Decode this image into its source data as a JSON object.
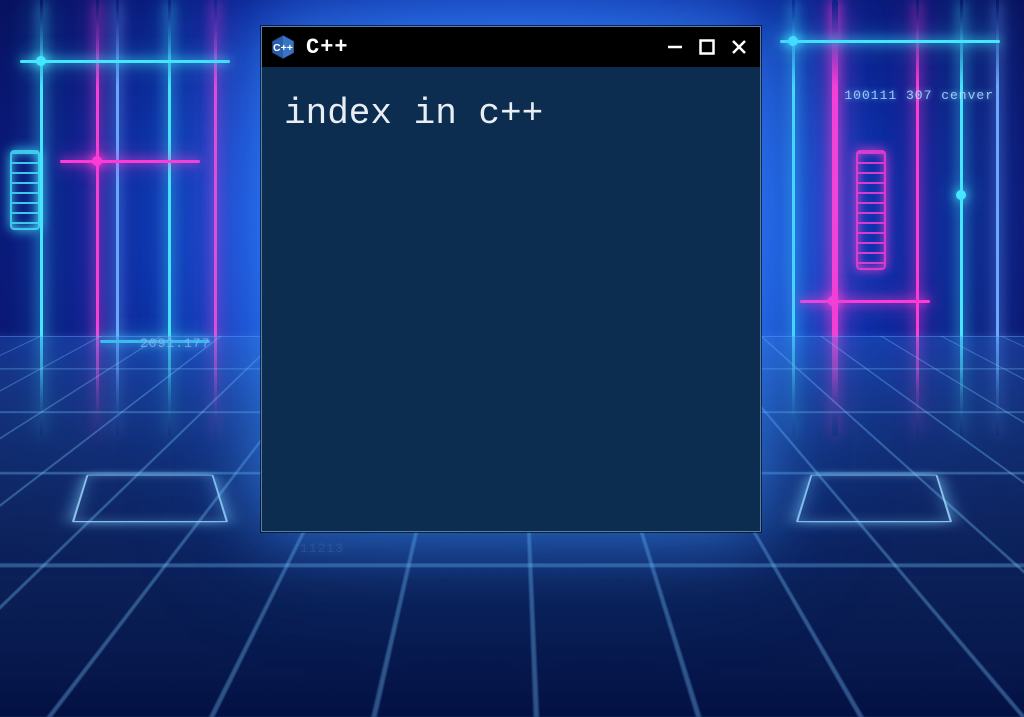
{
  "window": {
    "title": "C++",
    "icon_name": "cpp-hex-icon"
  },
  "terminal": {
    "content": "index in c++"
  },
  "background_text": {
    "right_top": "100111 307 cenver",
    "left_mid": "2091.177",
    "bottom": "11213"
  },
  "colors": {
    "terminal_bg": "#0c2d50",
    "titlebar_bg": "#000000",
    "text": "#e8eef4",
    "neon_cyan": "#45e6ff",
    "neon_pink": "#ff3bd4"
  }
}
